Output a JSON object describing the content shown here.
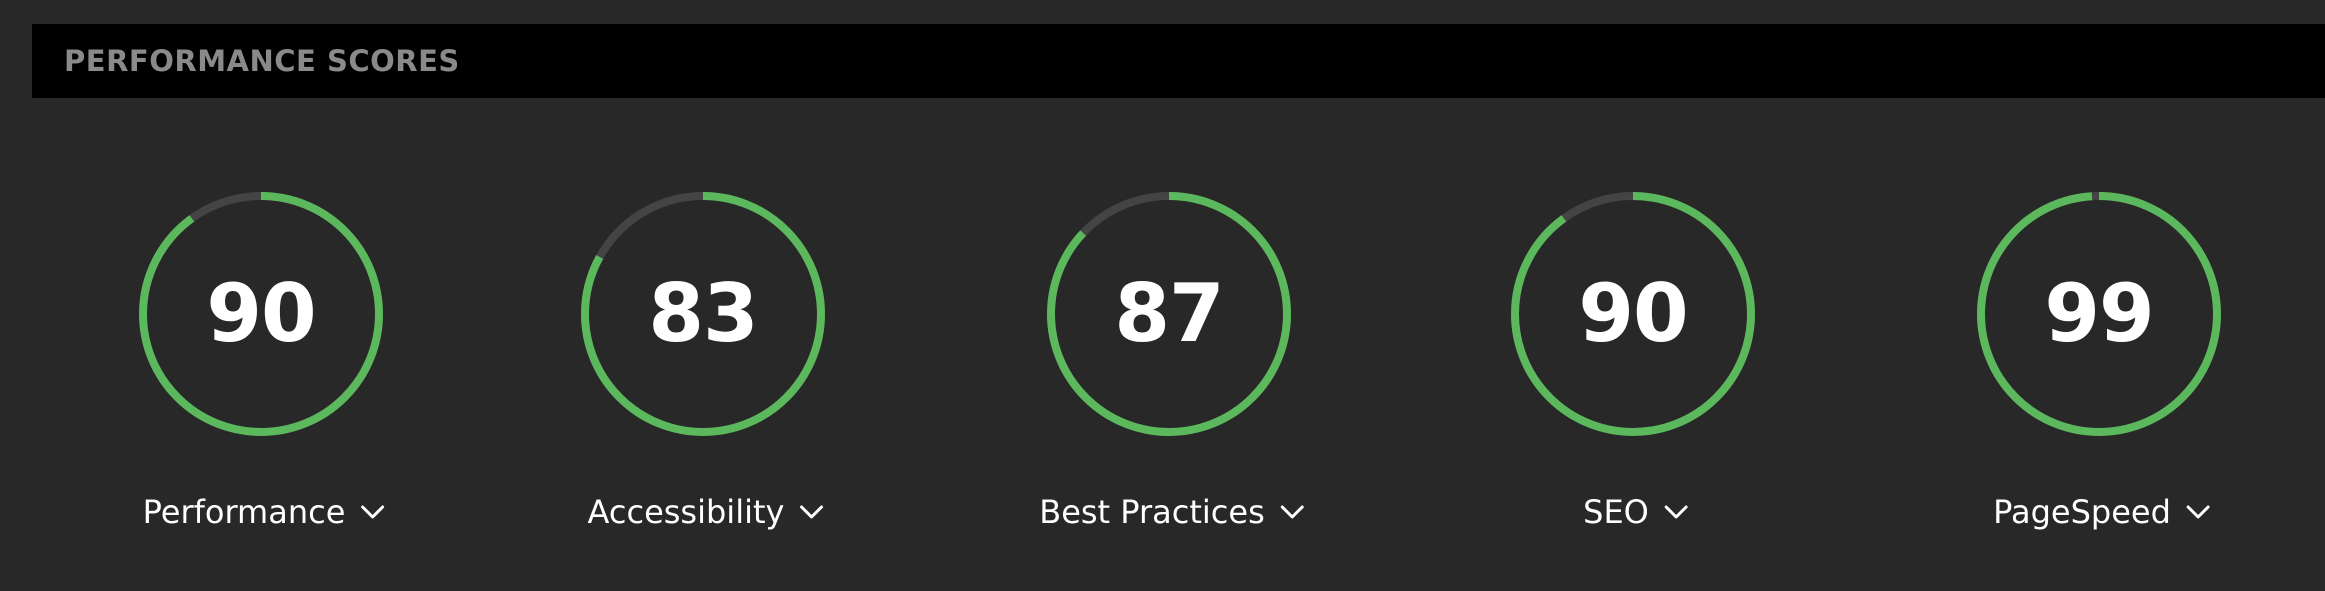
{
  "header": {
    "title": "PERFORMANCE SCORES"
  },
  "colors": {
    "background": "#282828",
    "header_background": "#000000",
    "header_text": "#8a8a8a",
    "ring_good": "#5cb85c",
    "ring_track": "#444444",
    "text": "#ffffff"
  },
  "scores": [
    {
      "label": "Performance",
      "value": "90",
      "percent": 90,
      "icon": "chevron-down-icon"
    },
    {
      "label": "Accessibility",
      "value": "83",
      "percent": 83,
      "icon": "chevron-down-icon"
    },
    {
      "label": "Best Practices",
      "value": "87",
      "percent": 87,
      "icon": "chevron-down-icon"
    },
    {
      "label": "SEO",
      "value": "90",
      "percent": 90,
      "icon": "chevron-down-icon"
    },
    {
      "label": "PageSpeed",
      "value": "99",
      "percent": 99,
      "icon": "chevron-down-icon"
    }
  ]
}
